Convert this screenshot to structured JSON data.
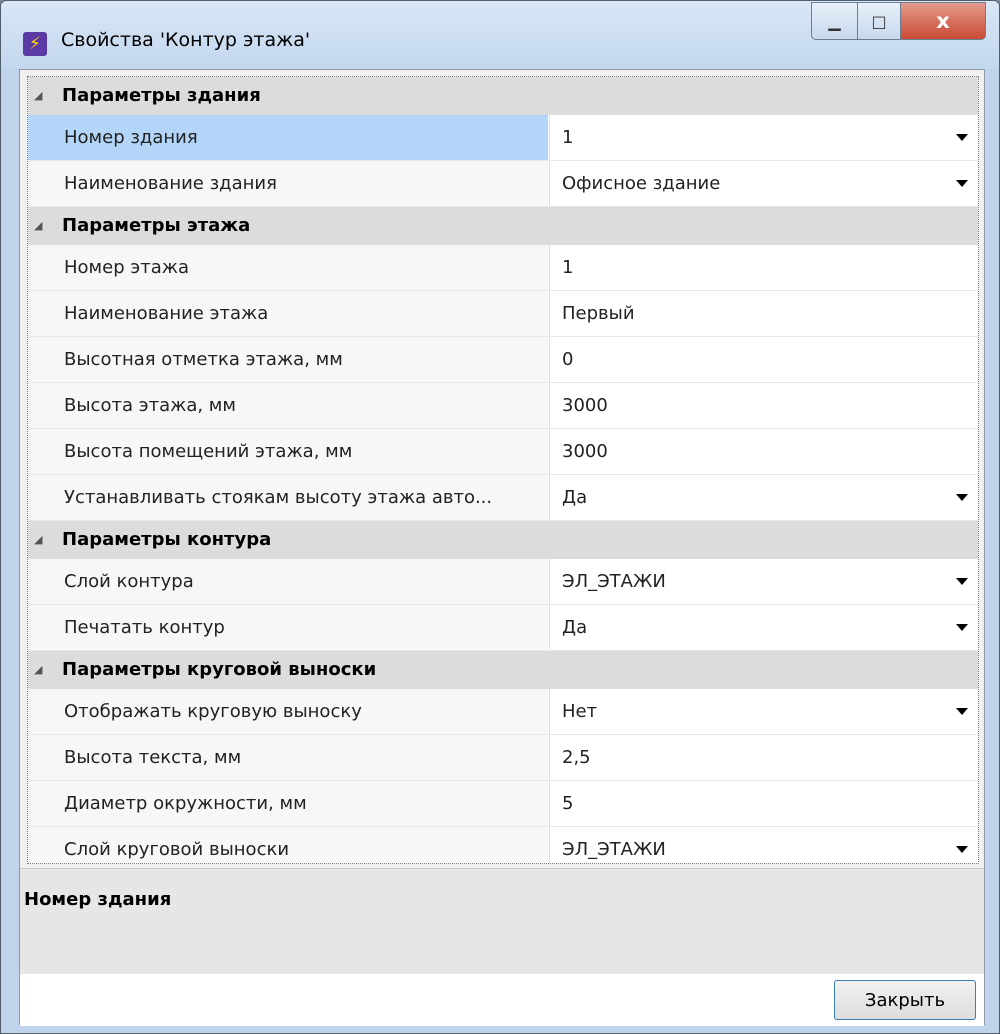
{
  "window": {
    "title": "Свойства 'Контур этажа'",
    "close_glyph": "x",
    "maximize_glyph": "□",
    "minimize_glyph": "▁"
  },
  "grid": {
    "categories": [
      {
        "label": "Параметры здания",
        "rows": [
          {
            "name": "Номер здания",
            "value": "1",
            "dropdown": true,
            "selected": true
          },
          {
            "name": "Наименование здания",
            "value": "Офисное здание",
            "dropdown": true
          }
        ]
      },
      {
        "label": "Параметры этажа",
        "rows": [
          {
            "name": "Номер этажа",
            "value": "1"
          },
          {
            "name": "Наименование этажа",
            "value": "Первый"
          },
          {
            "name": "Высотная отметка этажа, мм",
            "value": "0"
          },
          {
            "name": "Высота этажа, мм",
            "value": "3000"
          },
          {
            "name": "Высота помещений этажа, мм",
            "value": "3000"
          },
          {
            "name": "Устанавливать стоякам высоту этажа авто...",
            "value": "Да",
            "dropdown": true
          }
        ]
      },
      {
        "label": "Параметры контура",
        "rows": [
          {
            "name": "Слой контура",
            "value": "ЭЛ_ЭТАЖИ",
            "dropdown": true
          },
          {
            "name": "Печатать контур",
            "value": "Да",
            "dropdown": true
          }
        ]
      },
      {
        "label": "Параметры круговой выноски",
        "rows": [
          {
            "name": "Отображать круговую выноску",
            "value": "Нет",
            "dropdown": true
          },
          {
            "name": "Высота текста, мм",
            "value": "2,5"
          },
          {
            "name": "Диаметр окружности, мм",
            "value": "5"
          },
          {
            "name": "Слой круговой выноски",
            "value": "ЭЛ_ЭТАЖИ",
            "dropdown": true
          }
        ]
      }
    ]
  },
  "description": {
    "title": "Номер здания"
  },
  "footer": {
    "close_label": "Закрыть"
  },
  "colors": {
    "selection": "#b3d5f8",
    "category_bg": "#dcdcdc",
    "accent_border": "#3c7fb1"
  }
}
